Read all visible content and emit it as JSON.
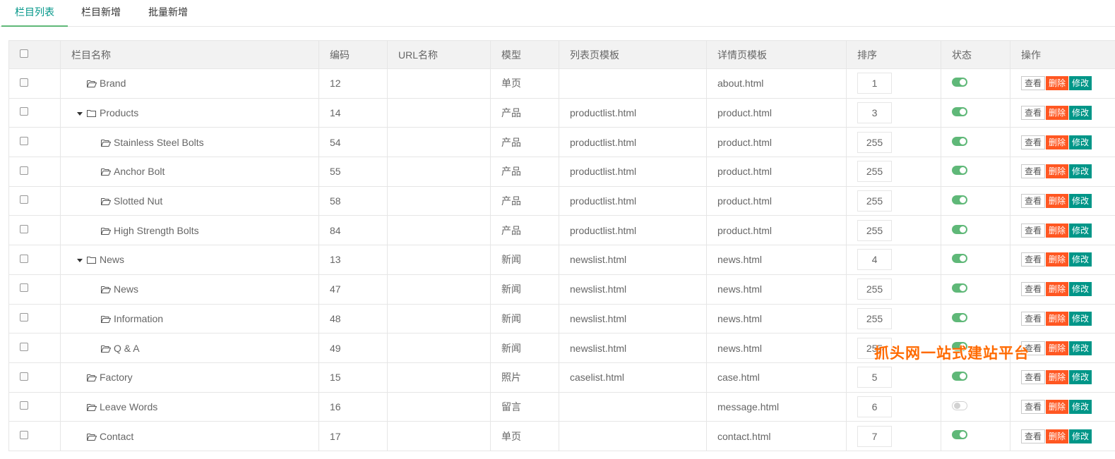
{
  "tabs": [
    {
      "label": "栏目列表",
      "active": true
    },
    {
      "label": "栏目新增",
      "active": false
    },
    {
      "label": "批量新增",
      "active": false
    }
  ],
  "table": {
    "headers": {
      "name": "栏目名称",
      "code": "编码",
      "url": "URL名称",
      "model": "模型",
      "list_tpl": "列表页模板",
      "detail_tpl": "详情页模板",
      "sort": "排序",
      "status": "状态",
      "ops": "操作"
    },
    "rows": [
      {
        "name": "Brand",
        "level": 0,
        "expanded": false,
        "folder": "open",
        "code": "12",
        "url": "",
        "model": "单页",
        "list_tpl": "",
        "detail_tpl": "about.html",
        "sort": "1",
        "status": "on"
      },
      {
        "name": "Products",
        "level": 0,
        "expanded": true,
        "folder": "closed",
        "code": "14",
        "url": "",
        "model": "产品",
        "list_tpl": "productlist.html",
        "detail_tpl": "product.html",
        "sort": "3",
        "status": "on"
      },
      {
        "name": "Stainless Steel Bolts",
        "level": 1,
        "expanded": false,
        "folder": "open",
        "code": "54",
        "url": "",
        "model": "产品",
        "list_tpl": "productlist.html",
        "detail_tpl": "product.html",
        "sort": "255",
        "status": "on"
      },
      {
        "name": "Anchor Bolt",
        "level": 1,
        "expanded": false,
        "folder": "open",
        "code": "55",
        "url": "",
        "model": "产品",
        "list_tpl": "productlist.html",
        "detail_tpl": "product.html",
        "sort": "255",
        "status": "on"
      },
      {
        "name": "Slotted Nut",
        "level": 1,
        "expanded": false,
        "folder": "open",
        "code": "58",
        "url": "",
        "model": "产品",
        "list_tpl": "productlist.html",
        "detail_tpl": "product.html",
        "sort": "255",
        "status": "on"
      },
      {
        "name": "High Strength Bolts",
        "level": 1,
        "expanded": false,
        "folder": "open",
        "code": "84",
        "url": "",
        "model": "产品",
        "list_tpl": "productlist.html",
        "detail_tpl": "product.html",
        "sort": "255",
        "status": "on"
      },
      {
        "name": "News",
        "level": 0,
        "expanded": true,
        "folder": "closed",
        "code": "13",
        "url": "",
        "model": "新闻",
        "list_tpl": "newslist.html",
        "detail_tpl": "news.html",
        "sort": "4",
        "status": "on"
      },
      {
        "name": "News",
        "level": 1,
        "expanded": false,
        "folder": "open",
        "code": "47",
        "url": "",
        "model": "新闻",
        "list_tpl": "newslist.html",
        "detail_tpl": "news.html",
        "sort": "255",
        "status": "on"
      },
      {
        "name": "Information",
        "level": 1,
        "expanded": false,
        "folder": "open",
        "code": "48",
        "url": "",
        "model": "新闻",
        "list_tpl": "newslist.html",
        "detail_tpl": "news.html",
        "sort": "255",
        "status": "on"
      },
      {
        "name": "Q & A",
        "level": 1,
        "expanded": false,
        "folder": "open",
        "code": "49",
        "url": "",
        "model": "新闻",
        "list_tpl": "newslist.html",
        "detail_tpl": "news.html",
        "sort": "255",
        "status": "on"
      },
      {
        "name": "Factory",
        "level": 0,
        "expanded": false,
        "folder": "open",
        "code": "15",
        "url": "",
        "model": "照片",
        "list_tpl": "caselist.html",
        "detail_tpl": "case.html",
        "sort": "5",
        "status": "on"
      },
      {
        "name": "Leave Words",
        "level": 0,
        "expanded": false,
        "folder": "open",
        "code": "16",
        "url": "",
        "model": "留言",
        "list_tpl": "",
        "detail_tpl": "message.html",
        "sort": "6",
        "status": "off"
      },
      {
        "name": "Contact",
        "level": 0,
        "expanded": false,
        "folder": "open",
        "code": "17",
        "url": "",
        "model": "单页",
        "list_tpl": "",
        "detail_tpl": "contact.html",
        "sort": "7",
        "status": "on"
      }
    ]
  },
  "actions": {
    "view": "查看",
    "delete": "删除",
    "edit": "修改"
  },
  "watermark": "抓头网一站式建站平台",
  "colors": {
    "accent": "#009688",
    "switch_on": "#5fb878",
    "delete": "#ff5722",
    "header_bg": "#f2f2f2",
    "border": "#e6e6e6"
  }
}
